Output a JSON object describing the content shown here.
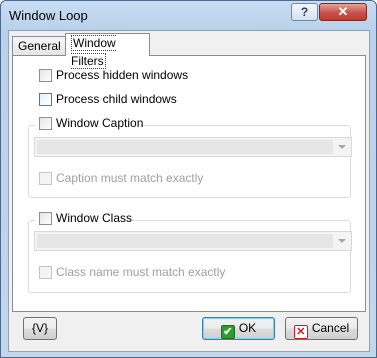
{
  "window": {
    "title": "Window Loop",
    "help_glyph": "?",
    "close_glyph": "✕"
  },
  "tabs": [
    {
      "label": "General",
      "selected": false
    },
    {
      "label": "Window Filters",
      "selected": true
    }
  ],
  "filters": {
    "process_hidden": {
      "label": "Process hidden windows",
      "checked": false
    },
    "process_child": {
      "label": "Process child windows",
      "checked": false
    },
    "caption_group": {
      "label": "Window Caption",
      "checked": false,
      "combo_value": "",
      "match_label": "Caption must match exactly"
    },
    "class_group": {
      "label": "Window Class",
      "checked": false,
      "combo_value": "",
      "match_label": "Class name must match exactly"
    }
  },
  "buttons": {
    "variables": "{V}",
    "ok": "OK",
    "cancel": "Cancel"
  },
  "icons": {
    "ok": "check-icon",
    "cancel": "x-icon"
  },
  "colors": {
    "title_bar": "#b9d1ea",
    "close_button": "#c75050",
    "ok_check": "#2e9d2e",
    "cancel_x": "#c0251b"
  }
}
